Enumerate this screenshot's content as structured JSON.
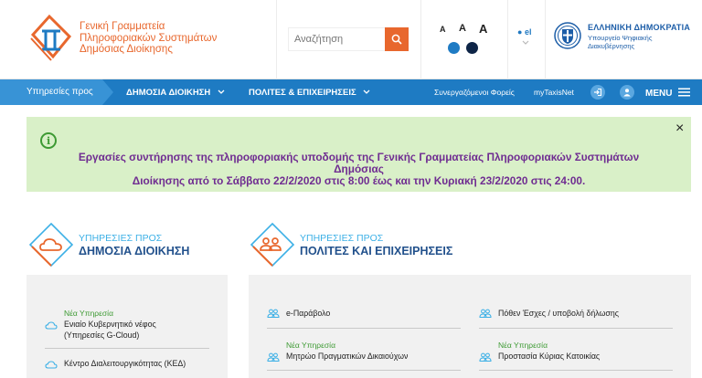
{
  "header": {
    "logo_lines": [
      "Γενική Γραμματεία",
      "Πληροφοριακών Συστημάτων",
      "Δημόσιας Διοίκησης"
    ],
    "search_placeholder": "Αναζήτηση",
    "font_sizes": [
      "A",
      "A",
      "A"
    ],
    "contrast_colors": [
      "#1f7bc4",
      "#0e2547"
    ],
    "language": "el",
    "gov_title": "ΕΛΛΗΝΙΚΗ ΔΗΜΟΚΡΑΤΙΑ",
    "gov_subtitle_lines": [
      "Υπουργείο Ψηφιακής",
      "Διακυβέρνησης"
    ]
  },
  "nav": {
    "services_for": "Υπηρεσίες προς",
    "items": [
      "ΔΗΜΟΣΙΑ ΔΙΟΙΚΗΣΗ",
      "ΠΟΛΙΤΕΣ & ΕΠΙΧΕΙΡΗΣΕΙΣ"
    ],
    "links": [
      "Συνεργαζόμενοι Φορείς",
      "myTaxisNet"
    ],
    "menu_label": "MENU"
  },
  "alert": {
    "icon": "info-icon",
    "line1": "Εργασίες συντήρησης της πληροφοριακής υποδομής της Γενικής Γραμματείας Πληροφοριακών Συστημάτων Δημόσιας",
    "line2": "Διοίκησης από το Σάββατο 22/2/2020 στις 8:00 έως και την Κυριακή 23/2/2020 στις 24:00.",
    "close": "×"
  },
  "sections": {
    "public": {
      "pre": "ΥΠΗΡΕΣΙΕΣ ΠΡΟΣ",
      "title": "ΔΗΜΟΣΙΑ ΔΙΟΙΚΗΣΗ",
      "services": [
        {
          "badge": "Νέα Υπηρεσία",
          "lines": [
            "Ενιαίο Κυβερνητικό νέφος",
            "(Υπηρεσίες G-Cloud)"
          ]
        },
        {
          "badge": "",
          "lines": [
            "Κέντρο Διαλειτουργικότητας (ΚΕΔ)"
          ]
        }
      ]
    },
    "citizens": {
      "pre": "ΥΠΗΡΕΣΙΕΣ ΠΡΟΣ",
      "title": "ΠΟΛΙΤΕΣ ΚΑΙ ΕΠΙΧΕΙΡΗΣΕΙΣ",
      "services": [
        {
          "badge": "",
          "text": "e-Παράβολο"
        },
        {
          "badge": "",
          "text": "Πόθεν Έσχες / υποβολή δήλωσης"
        },
        {
          "badge": "Νέα Υπηρεσία",
          "text": "Μητρώο Πραγματικών Δικαιούχων"
        },
        {
          "badge": "Νέα Υπηρεσία",
          "text": "Προστασία Κύριας Κατοικίας"
        }
      ]
    }
  }
}
